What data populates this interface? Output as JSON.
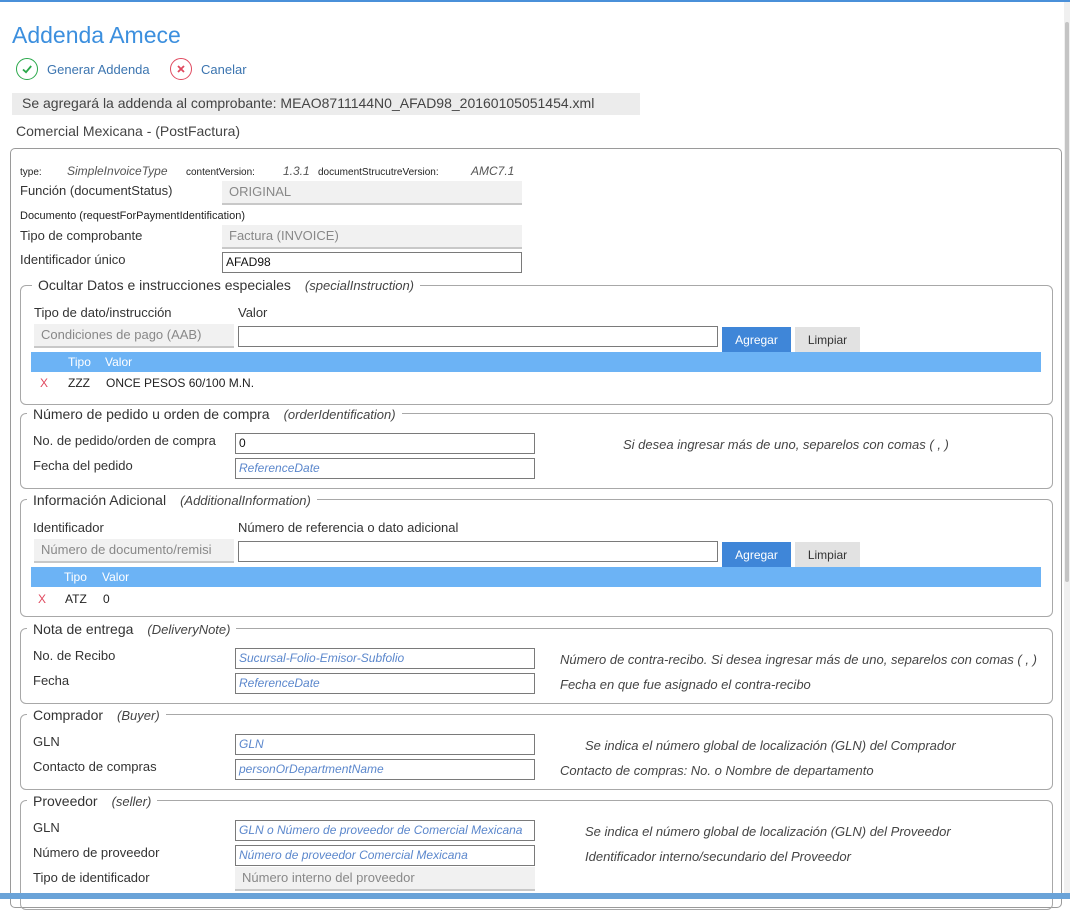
{
  "header": {
    "title": "Addenda Amece",
    "generate_label": "Generar Addenda",
    "cancel_label": "Canelar",
    "notice": "Se agregará la addenda al comprobante: MEAO8711144N0_AFAD98_20160105051454.xml",
    "subtitle": "Comercial Mexicana - (PostFactura)"
  },
  "meta": {
    "type_label": "type:",
    "type_value": "SimpleInvoiceType",
    "content_version_label": "contentVersion:",
    "content_version_value": "1.3.1",
    "doc_version_label": "documentStrucutreVersion:",
    "doc_version_value": "AMC7.1"
  },
  "general": {
    "funcion_label": "Función (documentStatus)",
    "funcion_value": "ORIGINAL",
    "documento_label": "Documento (requestForPaymentIdentification)",
    "tipo_label": "Tipo de comprobante",
    "tipo_value": "Factura (INVOICE)",
    "id_label": "Identificador único",
    "id_value": "AFAD98"
  },
  "special": {
    "legend": "Ocultar  Datos e instrucciones especiales",
    "legend_tag": "(specialInstruction)",
    "col1_label": "Tipo de dato/instrucción",
    "col2_label": "Valor",
    "select_value": "Condiciones de pago (AAB)",
    "add_label": "Agregar",
    "clear_label": "Limpiar",
    "table_headers": [
      "Tipo",
      "Valor"
    ],
    "rows": [
      {
        "delete": "X",
        "tipo": "ZZZ",
        "valor": "ONCE PESOS 60/100 M.N."
      }
    ]
  },
  "order": {
    "legend": "Número de pedido u orden de compra",
    "legend_tag": "(orderIdentification)",
    "number_label": "No. de pedido/orden de compra",
    "number_value": "0",
    "date_label": "Fecha del pedido",
    "date_placeholder": "ReferenceDate",
    "hint": "Si desea ingresar más de uno, separelos con comas ( , )"
  },
  "additional": {
    "legend": "Información Adicional",
    "legend_tag": "(AdditionalInformation)",
    "col1_label": "Identificador",
    "col2_label": "Número de referencia o dato adicional",
    "select_value": "Número de documento/remisi",
    "add_label": "Agregar",
    "clear_label": "Limpiar",
    "table_headers": [
      "Tipo",
      "Valor"
    ],
    "rows": [
      {
        "delete": "X",
        "tipo": "ATZ",
        "valor": "0"
      }
    ]
  },
  "delivery": {
    "legend": "Nota de entrega",
    "legend_tag": "(DeliveryNote)",
    "receipt_label": "No. de Recibo",
    "receipt_placeholder": "Sucursal-Folio-Emisor-Subfolio",
    "receipt_hint": "Número de contra-recibo. Si desea ingresar más de uno, separelos con comas ( , )",
    "date_label": "Fecha",
    "date_placeholder": "ReferenceDate",
    "date_hint": "Fecha en que fue asignado el contra-recibo"
  },
  "buyer": {
    "legend": "Comprador",
    "legend_tag": "(Buyer)",
    "gln_label": "GLN",
    "gln_placeholder": "GLN",
    "gln_hint": "Se indica el número global de localización (GLN) del Comprador",
    "contact_label": "Contacto de compras",
    "contact_placeholder": "personOrDepartmentName",
    "contact_hint": "Contacto de compras: No. o Nombre de departamento"
  },
  "seller": {
    "legend": "Proveedor",
    "legend_tag": "(seller)",
    "gln_label": "GLN",
    "gln_placeholder": "GLN o Número de proveedor de Comercial Mexicana",
    "gln_hint": "Se indica el número global de localización (GLN) del Proveedor",
    "supplier_label": "Número de proveedor",
    "supplier_placeholder": "Número de proveedor Comercial Mexicana",
    "supplier_hint": "Identificador interno/secundario del Proveedor",
    "idtype_label": "Tipo de identificador",
    "idtype_value": "Número interno del proveedor"
  }
}
